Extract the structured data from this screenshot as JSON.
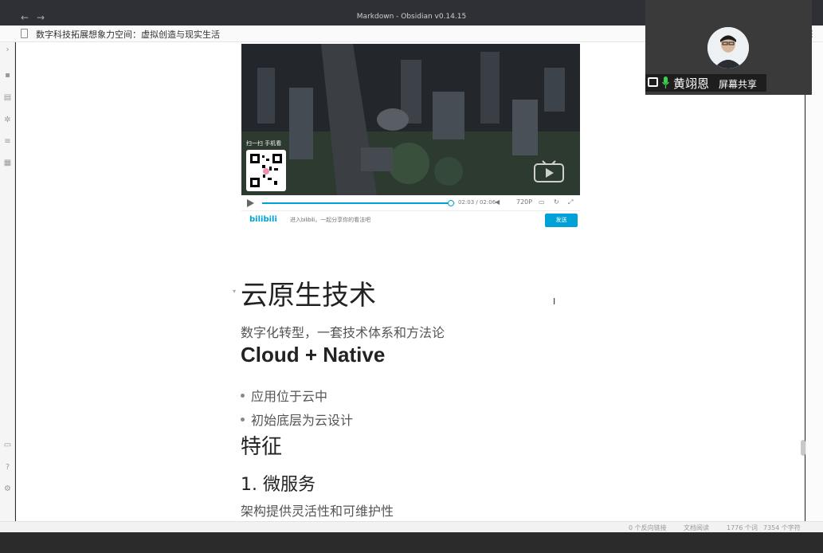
{
  "window": {
    "title": "Markdown - Obsidian v0.14.15",
    "back": "←",
    "forward": "→"
  },
  "tab": {
    "doc_title": "数字科技拓展想象力空间：虚拟创造与现实生活",
    "right_glyph": "⋮"
  },
  "video": {
    "qr_label": "扫一扫 手机看",
    "time": "02:03 / 02:06",
    "quality": "720P",
    "progress": 0.98,
    "danmaku_placeholder": "进入bilibili，一起分享你的看法吧",
    "send_label": "发送",
    "logo": "bilibili"
  },
  "doc": {
    "heading1": "云原生技术",
    "paragraph1": "数字化转型，一套技术体系和方法论",
    "heading_en": "Cloud + Native",
    "bullets": [
      "应用位于云中",
      "初始底层为云设计"
    ],
    "heading_features": "特征",
    "heading_micro": "1. 微服务",
    "paragraph2": "架构提供灵活性和可维护性"
  },
  "status": {
    "backlinks": "0 个反向链接",
    "mode": "文档阅读",
    "words": "1776 个词",
    "chars": "7354 个字符"
  },
  "webcam": {
    "name": "黄翊恩",
    "label": "屏幕共享"
  },
  "colors": {
    "accent": "#00a1d6",
    "titlebar": "#2f3035",
    "mic": "#3ccf4e"
  },
  "icons": {
    "ribbon": [
      "pin-icon",
      "file-icon",
      "graph-icon",
      "tags-icon",
      "vault-icon",
      "help-icon",
      "settings-icon"
    ]
  }
}
